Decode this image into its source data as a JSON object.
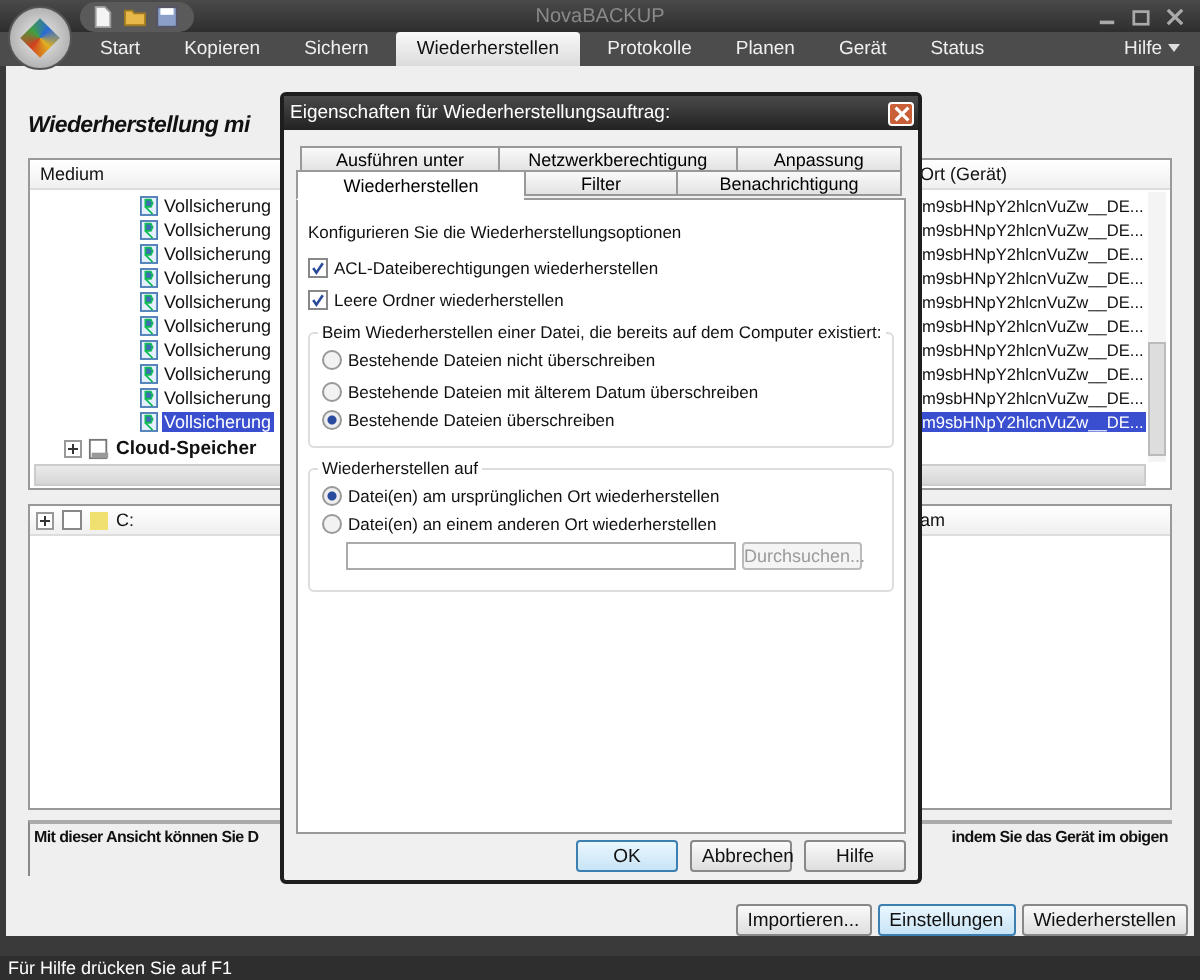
{
  "window": {
    "title": "NovaBACKUP"
  },
  "ribbon_tabs": [
    {
      "label": "Start",
      "selected": false
    },
    {
      "label": "Kopieren",
      "selected": false
    },
    {
      "label": "Sichern",
      "selected": false
    },
    {
      "label": "Wiederherstellen",
      "selected": true
    },
    {
      "label": "Protokolle",
      "selected": false
    },
    {
      "label": "Planen",
      "selected": false
    },
    {
      "label": "Gerät",
      "selected": false
    },
    {
      "label": "Status",
      "selected": false
    }
  ],
  "help_menu": {
    "label": "Hilfe"
  },
  "heading": "Wiederherstellung mi",
  "media_panel": {
    "columns": [
      "Medium",
      "Ort (Gerät)"
    ],
    "rows": [
      {
        "name": "Vollsicherung",
        "location": "m9sbHNpY2hlcnVuZw__DE...",
        "selected": false
      },
      {
        "name": "Vollsicherung",
        "location": "m9sbHNpY2hlcnVuZw__DE...",
        "selected": false
      },
      {
        "name": "Vollsicherung",
        "location": "m9sbHNpY2hlcnVuZw__DE...",
        "selected": false
      },
      {
        "name": "Vollsicherung",
        "location": "m9sbHNpY2hlcnVuZw__DE...",
        "selected": false
      },
      {
        "name": "Vollsicherung",
        "location": "m9sbHNpY2hlcnVuZw__DE...",
        "selected": false
      },
      {
        "name": "Vollsicherung",
        "location": "m9sbHNpY2hlcnVuZw__DE...",
        "selected": false
      },
      {
        "name": "Vollsicherung",
        "location": "m9sbHNpY2hlcnVuZw__DE...",
        "selected": false
      },
      {
        "name": "Vollsicherung",
        "location": "m9sbHNpY2hlcnVuZw__DE...",
        "selected": false
      },
      {
        "name": "Vollsicherung",
        "location": "m9sbHNpY2hlcnVuZw__DE...",
        "selected": false
      },
      {
        "name": "Vollsicherung",
        "location": "m9sbHNpY2hlcnVuZw__DE...",
        "selected": true
      }
    ],
    "cloud": {
      "label": "Cloud-Speicher",
      "expanded": false
    }
  },
  "files_panel": {
    "drive": {
      "label": "C:",
      "checked": false,
      "expanded": false
    },
    "column_2": "am"
  },
  "info_text": {
    "left": "Mit dieser Ansicht können Sie D",
    "right": "indem Sie das Gerät im obigen"
  },
  "buttons": [
    {
      "label": "Importieren...",
      "focused": false
    },
    {
      "label": "Einstellungen",
      "focused": true
    },
    {
      "label": "Wiederherstellen",
      "focused": false
    }
  ],
  "status_bar": "Für Hilfe drücken Sie auf F1",
  "dialog": {
    "title": "Eigenschaften für Wiederherstellungsauftrag:",
    "tab_rows": [
      [
        {
          "label": "Ausführen unter",
          "selected": false
        },
        {
          "label": "Netzwerkberechtigung",
          "selected": false
        },
        {
          "label": "Anpassung",
          "selected": false
        }
      ],
      [
        {
          "label": "Wiederherstellen",
          "selected": true
        },
        {
          "label": "Filter",
          "selected": false
        },
        {
          "label": "Benachrichtigung",
          "selected": false
        }
      ]
    ],
    "intro": "Konfigurieren Sie die Wiederherstellungsoptionen",
    "checkboxes": [
      {
        "label": "ACL-Dateiberechtigungen wiederherstellen",
        "checked": true
      },
      {
        "label": "Leere Ordner wiederherstellen",
        "checked": true
      }
    ],
    "overwrite_group": {
      "legend": "Beim Wiederherstellen einer Datei, die bereits auf dem Computer existiert:",
      "options": [
        {
          "label": "Bestehende Dateien nicht überschreiben",
          "selected": false
        },
        {
          "label": "Bestehende Dateien mit älterem Datum überschreiben",
          "selected": false
        },
        {
          "label": "Bestehende Dateien überschreiben",
          "selected": true
        }
      ]
    },
    "target_group": {
      "legend": "Wiederherstellen auf",
      "options": [
        {
          "label": "Datei(en) am ursprünglichen Ort wiederherstellen",
          "selected": true
        },
        {
          "label": "Datei(en) an einem anderen Ort wiederherstellen",
          "selected": false
        }
      ],
      "browse": {
        "label": "Durchsuchen...",
        "disabled": true
      }
    },
    "buttons": [
      {
        "label": "OK",
        "focused": true
      },
      {
        "label": "Abbrechen",
        "focused": false
      },
      {
        "label": "Hilfe",
        "focused": false
      }
    ]
  }
}
